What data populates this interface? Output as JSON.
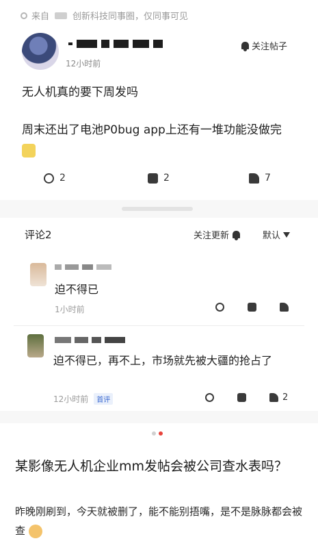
{
  "source": {
    "prefix": "来自",
    "suffix": "创新科技同事圈，仅同事可见"
  },
  "post": {
    "time": "12小时前",
    "follow_label": "关注帖子",
    "title": "无人机真的要下周发吗",
    "body": "周末还出了电池P0bug app上还有一堆功能没做完",
    "actions": {
      "edit_count": "2",
      "comment_count": "2",
      "like_count": "7"
    }
  },
  "comments": {
    "header": "评论2",
    "follow_updates": "关注更新",
    "sort_label": "默认",
    "items": [
      {
        "text": "迫不得已",
        "time": "1小时前",
        "badge": "",
        "like_count": ""
      },
      {
        "text": "迫不得已，再不上，市场就先被大疆的抢占了",
        "time": "12小时前",
        "badge": "首评",
        "like_count": "2"
      }
    ]
  },
  "question": {
    "title": "某影像无人机企业mm发帖会被公司查水表吗？",
    "body": "昨晚刚刷到，今天就被删了，能不能别捂嘴，是不是脉脉都会被查"
  },
  "colors": {
    "accent_red": "#e8433b",
    "badge_blue": "#3c6ad1"
  }
}
